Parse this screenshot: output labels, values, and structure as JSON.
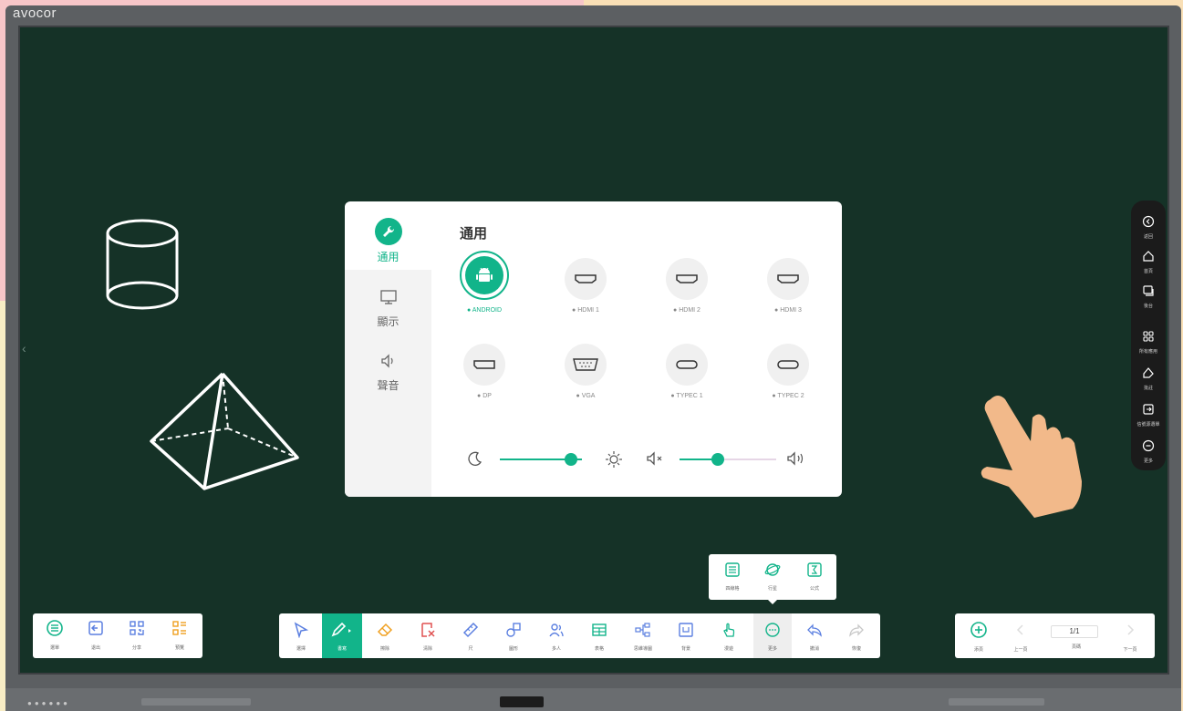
{
  "brand": "avocor",
  "settings_panel": {
    "title": "通用",
    "side_items": [
      {
        "label": "通用",
        "icon": "wrench-icon",
        "active": true
      },
      {
        "label": "顯示",
        "icon": "monitor-icon",
        "active": false
      },
      {
        "label": "聲音",
        "icon": "speaker-icon",
        "active": false
      }
    ],
    "sources": [
      {
        "label": "ANDROID",
        "icon": "android-icon",
        "active": true
      },
      {
        "label": "HDMI 1",
        "icon": "hdmi-icon"
      },
      {
        "label": "HDMI 2",
        "icon": "hdmi-icon"
      },
      {
        "label": "HDMI 3",
        "icon": "hdmi-icon"
      },
      {
        "label": "DP",
        "icon": "dp-icon"
      },
      {
        "label": "VGA",
        "icon": "vga-icon"
      },
      {
        "label": "TYPEC 1",
        "icon": "typec-icon"
      },
      {
        "label": "TYPEC 2",
        "icon": "typec-icon"
      }
    ],
    "brightness_level": 0.87,
    "volume_level": 0.4,
    "accent_color": "#12b48a"
  },
  "right_sidebar": [
    {
      "label": "返回",
      "icon": "back-icon"
    },
    {
      "label": "首頁",
      "icon": "home-icon"
    },
    {
      "label": "後台",
      "icon": "recent-apps-icon"
    },
    {
      "label": "所有應用",
      "icon": "all-apps-icon"
    },
    {
      "label": "批註",
      "icon": "annotate-icon"
    },
    {
      "label": "信號源選單",
      "icon": "input-source-icon"
    },
    {
      "label": "更多",
      "icon": "more-icon"
    }
  ],
  "left_toolbar": [
    {
      "label": "選單",
      "icon": "menu-icon"
    },
    {
      "label": "退出",
      "icon": "exit-icon"
    },
    {
      "label": "分享",
      "icon": "qr-share-icon"
    },
    {
      "label": "預覽",
      "icon": "preview-icon"
    }
  ],
  "center_toolbar": [
    {
      "label": "選擇",
      "icon": "select-icon"
    },
    {
      "label": "書寫",
      "icon": "pen-icon",
      "active": true
    },
    {
      "label": "擦除",
      "icon": "eraser-icon"
    },
    {
      "label": "清除",
      "icon": "clear-icon"
    },
    {
      "label": "尺",
      "icon": "ruler-icon"
    },
    {
      "label": "圖形",
      "icon": "shapes-icon"
    },
    {
      "label": "多人",
      "icon": "multi-user-icon"
    },
    {
      "label": "表格",
      "icon": "table-icon"
    },
    {
      "label": "思維導圖",
      "icon": "mind-map-icon"
    },
    {
      "label": "背景",
      "icon": "background-icon"
    },
    {
      "label": "漫遊",
      "icon": "roam-icon"
    },
    {
      "label": "更多",
      "icon": "more-icon",
      "highlighted": true
    },
    {
      "label": "撤消",
      "icon": "undo-icon"
    },
    {
      "label": "恢復",
      "icon": "redo-icon"
    }
  ],
  "more_popup": [
    {
      "label": "四線格",
      "icon": "four-line-icon"
    },
    {
      "label": "行星",
      "icon": "planet-icon"
    },
    {
      "label": "公式",
      "icon": "formula-icon"
    }
  ],
  "page_toolbar": {
    "add_label": "添頁",
    "prev_label": "上一頁",
    "page_label": "頁碼",
    "page_value": "1/1",
    "next_label": "下一頁"
  }
}
